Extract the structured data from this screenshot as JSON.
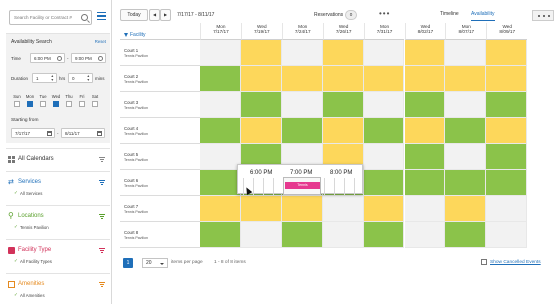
{
  "sidebar": {
    "search_placeholder": "Search Facility or Contract #",
    "availability": {
      "title": "Availability Search",
      "reset": "Reset",
      "time_label": "Time",
      "time_from": "6:00 PM",
      "time_sep": "-",
      "time_to": "9:00 PM",
      "duration_label": "Duration",
      "duration_value": "1",
      "duration_hrs": "hrs",
      "duration_min": "0",
      "duration_mins": "mins",
      "days": [
        {
          "label": "Sun",
          "checked": false
        },
        {
          "label": "Mon",
          "checked": true
        },
        {
          "label": "Tue",
          "checked": false
        },
        {
          "label": "Wed",
          "checked": true
        },
        {
          "label": "Thu",
          "checked": false
        },
        {
          "label": "Fri",
          "checked": false
        },
        {
          "label": "Sat",
          "checked": false
        }
      ],
      "starting_from_label": "Starting from",
      "start_date": "7/17/17",
      "date_sep": "-",
      "end_date": "8/11/17"
    },
    "all_calendars": "All Calendars",
    "sections": [
      {
        "title": "Services",
        "sub": "All Services",
        "color": "#1f6fb9",
        "icon": "services-icon"
      },
      {
        "title": "Locations",
        "sub": "Tennis Pavilion",
        "color": "#5aa02c",
        "icon": "location-pin-icon"
      },
      {
        "title": "Facility Type",
        "sub": "All Facility Types",
        "color": "#d2325a",
        "icon": "facility-building-icon"
      },
      {
        "title": "Amenities",
        "sub": "All Amenities",
        "color": "#e58a1f",
        "icon": "amenities-icon"
      }
    ]
  },
  "toolbar": {
    "today": "Today",
    "prev": "◀",
    "next": "▶",
    "date_range": "7/17/17 - 8/11/17",
    "reservations_label": "Reservations",
    "reservations_count": "0",
    "more": "•••",
    "tab_timeline": "Timeline",
    "tab_availability": "Availability"
  },
  "grid": {
    "facility_header": "Facility",
    "columns": [
      {
        "day": "Mon",
        "date": "7/17/17"
      },
      {
        "day": "Wed",
        "date": "7/19/17"
      },
      {
        "day": "Mon",
        "date": "7/24/17"
      },
      {
        "day": "Wed",
        "date": "7/26/17"
      },
      {
        "day": "Mon",
        "date": "7/31/17"
      },
      {
        "day": "Wed",
        "date": "8/02/17"
      },
      {
        "day": "Mon",
        "date": "8/07/17"
      },
      {
        "day": "Wed",
        "date": "8/09/17"
      }
    ],
    "rows": [
      {
        "name": "Court 1",
        "facility": "Tennis Pavilion",
        "cells": [
          "e",
          "y",
          "e",
          "y",
          "e",
          "y",
          "e",
          "y"
        ]
      },
      {
        "name": "Court 2",
        "facility": "Tennis Pavilion",
        "cells": [
          "g",
          "y",
          "y",
          "y",
          "y",
          "y",
          "y",
          "y"
        ]
      },
      {
        "name": "Court 3",
        "facility": "Tennis Pavilion",
        "cells": [
          "e",
          "g",
          "e",
          "g",
          "e",
          "g",
          "e",
          "g"
        ]
      },
      {
        "name": "Court 4",
        "facility": "Tennis Pavilion",
        "cells": [
          "g",
          "y",
          "g",
          "y",
          "g",
          "y",
          "g",
          "y"
        ]
      },
      {
        "name": "Court 5",
        "facility": "Tennis Pavilion",
        "cells": [
          "e",
          "g",
          "e",
          "y",
          "e",
          "g",
          "e",
          "g"
        ]
      },
      {
        "name": "Court 6",
        "facility": "Tennis Pavilion",
        "cells": [
          "g",
          "g",
          "g",
          "g",
          "g",
          "g",
          "g",
          "g"
        ]
      },
      {
        "name": "Court 7",
        "facility": "Tennis Pavilion",
        "cells": [
          "y",
          "y",
          "y",
          "e",
          "y",
          "e",
          "y",
          "e"
        ]
      },
      {
        "name": "Court 8",
        "facility": "Tennis Pavilion",
        "cells": [
          "g",
          "e",
          "g",
          "e",
          "g",
          "e",
          "g",
          "e"
        ]
      }
    ]
  },
  "popup": {
    "times": [
      "6:00 PM",
      "7:00 PM",
      "8:00 PM"
    ],
    "booking": "Tennis"
  },
  "footer": {
    "page": "1",
    "page_size": "20",
    "items_per_page": "items per page",
    "count": "1 - 8 of 8 items",
    "show_cancelled": "Show Cancelled Events"
  },
  "colors": {
    "accent": "#1f6fb9",
    "available": "#8bc34a",
    "partial": "#fdd75b",
    "empty": "#f2f2f2",
    "booking": "#e6398f"
  }
}
